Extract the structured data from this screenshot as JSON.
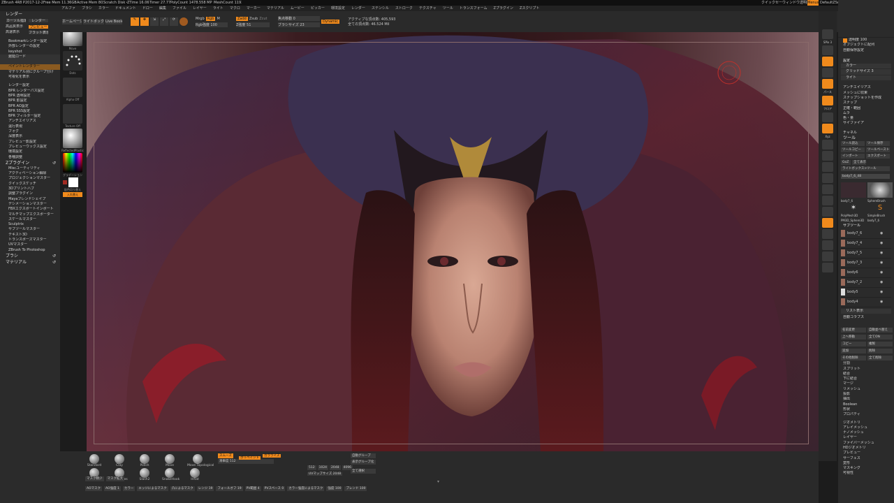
{
  "statusbar": {
    "app": "ZBrush 4R8 P2",
    "date": "2017-12-29",
    "free_mem": "Free Mem 11.36GB",
    "active_mem": "Active Mem 8026",
    "scratch": "Scratch Disk 48",
    "ztime": "ZTime 16.063",
    "timer": "Timer 27.773",
    "polycount": "PolyCount 1478.558 MP",
    "meshcount": "MeshCount 1193",
    "quicksave": "クイックセーブ",
    "transparency": "ウィンドウ透明度",
    "menus": "Menus",
    "defaultscript": "DefaultZScript"
  },
  "menubar": [
    "アルファ",
    "ブラシ",
    "カラー",
    "ドキュメント",
    "ドロー",
    "編集",
    "ファイル",
    "レイヤー",
    "ライト",
    "マクロ",
    "マーカー",
    "マテリアル",
    "ムービー",
    "ピッカー",
    "環境設定",
    "レンダー",
    "ステンシル",
    "ストローク",
    "テクスチャ",
    "ツール",
    "トランスフォーム",
    "Zプラグイン",
    "Zスクリプト"
  ],
  "leftpanel": {
    "render_title": "レンダー",
    "cursor_set": "カーソル指定",
    "render_btn": "レンダー",
    "hq_display": "高品質表示",
    "preview": "プレビュー",
    "fast_display": "高速表示",
    "flat_display": "フラット表示",
    "items1": [
      "Bookmarkレンダー設定",
      "外部レンダーの設定",
      "keyshot",
      "遅延ロード",
      "",
      "ペイントレンダラー",
      "マテリアル別にグループ分け",
      "可視化を表示"
    ],
    "items2": [
      "レンダー設定",
      "BPR レンダーパス設定",
      "BPR 透明設定",
      "BPR 影設定",
      "BPR AO設定",
      "BPR SSS設定",
      "BPR フィルター設定",
      "アンチエイリアス",
      "遠行表現",
      "フォグ",
      "深度表示",
      "プレビュー影設定",
      "プレビューウックス設定",
      "環境設定",
      "各種調整"
    ],
    "zplugin_title": "Zプラグイン",
    "items3": [
      "Miscユーティリティ",
      "アクティベーション解除",
      "プロジェクションマスター",
      "クイックスケッチ",
      "3Dプリントハブ",
      "調整プラグイン",
      "Mayaブレンドシェイプ",
      "デシメーションマスター",
      "FBXエクスポートインポート",
      "マルチマップエクスポーター",
      "スケールマスター",
      "Sculptrix",
      "サブツールマスター",
      "テキスト3D",
      "トランスポーズマスター",
      "UVマスター",
      "ZBrush To Photoshop"
    ],
    "brush_title": "ブラシ",
    "material_title": "マテリアル"
  },
  "brushcol": {
    "brush_label": "Move",
    "stroke_label": "Dots",
    "alpha_label": "Alpha Off",
    "texture_label": "Texture Off",
    "material_label": "ReflectedPlastic",
    "gradient_label": "グラデーション",
    "swap_label": "配色切り替え",
    "switch_label": "入れ替え"
  },
  "toptool": {
    "homepage": "ホームページ",
    "lightbox": "ライトボックス",
    "livebool": "Live Boolean",
    "edit_btn": "Edit",
    "draw_btn": "Draw",
    "mrgb": "Mrgb",
    "rgb": "Rgb",
    "m": "M",
    "zadd": "Zadd",
    "zsub": "Zsub",
    "zcut": "Zcut",
    "rgb_intensity": "Rgb強度 100",
    "z_intensity": "Z強度 51",
    "focal_shift": "焦点移動 0",
    "draw_size": "ブラシサイズ 23",
    "dynamic": "Dynamic",
    "active_points": "アクティブな頂点数: 405,593",
    "total_points": "全ての頂点数: 46.524 Mil"
  },
  "rightcol": [
    "SPix 3",
    "パース",
    "フロア",
    "ローカル",
    "Xyz",
    "",
    "",
    "",
    "",
    "",
    "",
    "",
    "",
    "",
    ""
  ],
  "rightpanel": {
    "palette1": [
      "透明度 100",
      "オブジェクトに配列",
      "自動保存設定"
    ],
    "palette_head": "設定",
    "rows": [
      "カラー",
      "グリッドサイズ 3",
      "ライト",
      "",
      "アンチエイリアス",
      "メッシュに収束",
      "スナップショットを作成",
      "スナップ",
      "正確・範囲",
      "ムラ",
      "色・量",
      "サイファイア"
    ],
    "channel": "チャネル",
    "tool_title": "ツール",
    "tool_btns": [
      "ツール読込",
      "ツール保存",
      "ツールコピー",
      "ツールペースト",
      "インポート",
      "エクスポート",
      "GoZ",
      "全て表示",
      "ライトボックス>ツール"
    ],
    "current_tool": "body7_6_48",
    "thumbs": [
      "body7_6",
      "SphereBrush",
      "PolyMesh3D",
      "SimpleBrush",
      "PM3D_Sphere3D",
      "body7_6"
    ],
    "subtool_head": "サブツール",
    "subtools": [
      "body7_6",
      "body7_4",
      "body7_5",
      "body7_3",
      "body6",
      "body7_2",
      "body5",
      "body4"
    ],
    "list_all": "リスト表示",
    "auto_collapse": "自動コラプス",
    "actions": [
      "名前変更",
      "自動並べ替え",
      "上へ移動",
      "全てON",
      "コピー",
      "複製",
      "追加",
      "削除",
      "その他削除",
      "全て削除",
      "分割",
      "スプリット",
      "結合",
      "下に結合",
      "マージ",
      "リメッシュ",
      "投影",
      "抽出",
      "Boolean",
      "形状",
      "プロパティ"
    ],
    "tail": [
      "ジオメトリ",
      "アレイメッシュ",
      "ナノメッシュ",
      "レイヤー",
      "ファイバーメッシュ",
      "HDジオメトリ",
      "プレビュー",
      "サーフェス",
      "変形",
      "マスキング",
      "可視性"
    ]
  },
  "bottomshelf": {
    "brushes": [
      "Standard",
      "Clay",
      "Move",
      "Move Topological",
      "Pinch",
      "Polish",
      "ClayTubes",
      "Slash2",
      "SnakeHook",
      "Inflat"
    ],
    "mask_a": "マスク精少",
    "mask_b": "マスク拡大",
    "sculpt": "スムーズ",
    "smooth_val": "滑車度 512",
    "polypaint": "ポリペイント",
    "colorize": "カラライズ",
    "uv_map": "UVマップサイズ 2048",
    "map_sizes": [
      "512",
      "1024",
      "2048",
      "4096"
    ],
    "edge_labels": [
      "AOマスク",
      "AO強度 1",
      "カラー",
      "エッジによるマスク",
      "凸によるマスク",
      "レンジ 19",
      "フォールオフ 19",
      "PV範囲 4",
      "PVスペース 0",
      "カラー強度によるマスク",
      "強度 100",
      "ブレンド 100"
    ],
    "auto_group": "自動グループ",
    "show_group": "表示グループ化",
    "all_select": "全て選択",
    "poly_groups": "ポリグループ",
    "texture_on": "テクスチャオン"
  },
  "colors": {
    "accent": "#f08a1c",
    "panel": "#2b2b2b",
    "bg": "#1c1c1c"
  }
}
